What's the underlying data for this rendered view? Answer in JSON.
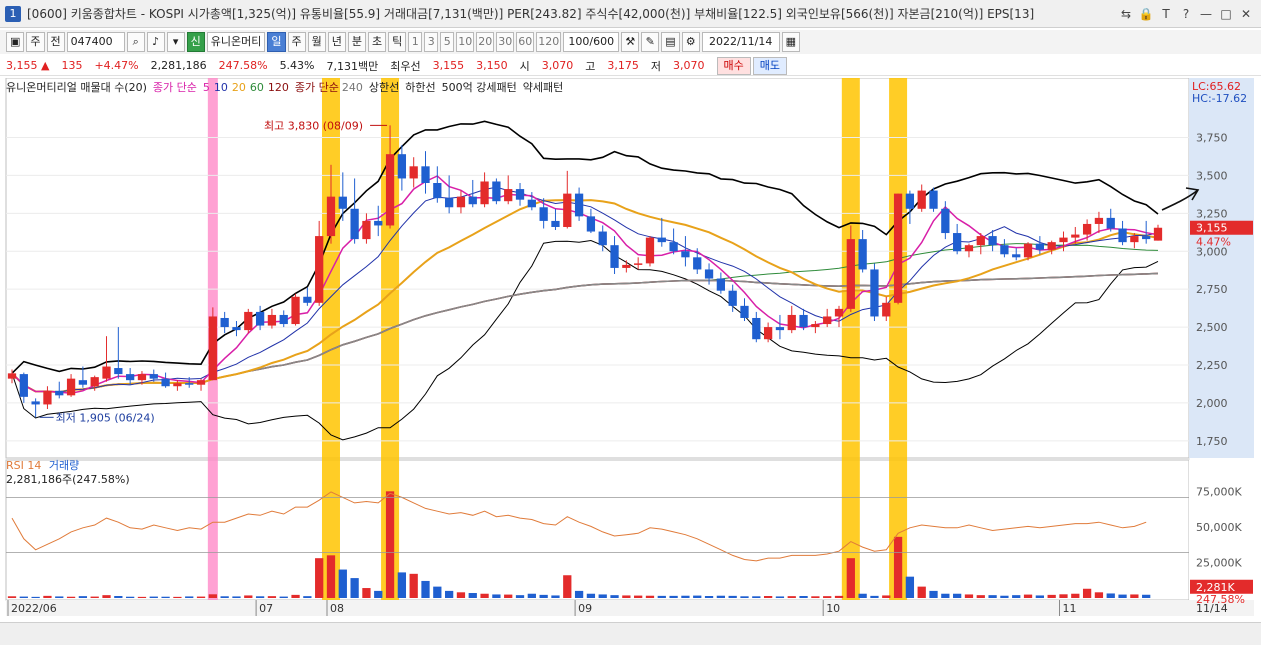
{
  "window": {
    "app_icon": "1",
    "title": "[0600] 키움종합차트 - KOSPI 시가총액[1,325(억)] 유통비율[55.9] 거래대금[7,131(백만)] PER[243.82] 주식수[42,000(천)] 부채비율[122.5] 외국인보유[566(천)] 자본금[210(억)] EPS[13]",
    "controls": [
      "⇆",
      "🔒",
      "T",
      "?",
      "—",
      "□",
      "✕"
    ]
  },
  "toolbar": {
    "period_select": "주",
    "prev": "전",
    "code": "047400",
    "name_prefix": "신",
    "name": "유니온머티",
    "periods": [
      "일",
      "주",
      "월",
      "년",
      "분",
      "초",
      "틱"
    ],
    "minutes": [
      "1",
      "3",
      "5",
      "10",
      "20",
      "30",
      "60",
      "120"
    ],
    "ratio": "100/600",
    "date": "2022/11/14"
  },
  "quote": {
    "price": "3,155 ▲",
    "change": "135",
    "change_pct": "+4.47%",
    "volume": "2,281,186",
    "vol_ratio": "247.58%",
    "turnover": "5.43%",
    "amount": "7,131백만",
    "best_label": "최우선",
    "best_ask": "3,155",
    "best_bid": "3,150",
    "open_label": "시",
    "open": "3,070",
    "high_label": "고",
    "high": "3,175",
    "low_label": "저",
    "low": "3,070",
    "buy": "매수",
    "sell": "매도"
  },
  "legend": {
    "vp_label": "유니온머티리얼 매물대 수(20)",
    "ma_label": "종가 단순",
    "ma_periods": [
      "5",
      "10",
      "20",
      "60",
      "120"
    ],
    "ma240_label": "종가 단순",
    "ma240": "240",
    "upper": "상한선",
    "lower": "하한선",
    "pattern_label": "500억 강세패턴",
    "weak": "약세패턴",
    "lc": "LC:65.62",
    "hc": "HC:-17.62",
    "rsi": "RSI 14",
    "vol": "거래량",
    "vol_value": "2,281,186주(247.58%)"
  },
  "colors": {
    "up": "#e32b2b",
    "down": "#1f5fd0",
    "ma5": "#d81fa8",
    "ma10": "#2233aa",
    "ma20": "#e8a21a",
    "ma60": "#2e8b3a",
    "ma120": "#8a0e0e",
    "ma240": "#888888",
    "band": "#000000",
    "highlight": "#ffc400",
    "pink": "#ff8ac8",
    "rsi": "#e07b3a"
  },
  "chart_data": {
    "type": "candlestick",
    "y_ticks": [
      "3,750",
      "3,500",
      "3,250",
      "3,000",
      "2,750",
      "2,500",
      "2,250",
      "2,000",
      "1,750"
    ],
    "ylim": [
      1650,
      4050
    ],
    "vol_ticks": [
      "75,000K",
      "50,000K",
      "25,000K"
    ],
    "vol_max": 90000,
    "x_labels": [
      "2022/06",
      "07",
      "08",
      "09",
      "10",
      "11"
    ],
    "x_label_right": "11/14",
    "current_price": "3,155",
    "current_pct": "4.47%",
    "current_vol": "2,281K",
    "current_vol_pct": "247.58%",
    "annot_high": "최고 3,830 (08/09)",
    "annot_low": "최저 1,905 (06/24)",
    "candles": [
      {
        "o": 2160,
        "h": 2220,
        "l": 2130,
        "c": 2195
      },
      {
        "o": 2190,
        "h": 2200,
        "l": 2000,
        "c": 2040
      },
      {
        "o": 2010,
        "h": 2030,
        "l": 1905,
        "c": 1990
      },
      {
        "o": 1990,
        "h": 2110,
        "l": 1960,
        "c": 2080
      },
      {
        "o": 2080,
        "h": 2140,
        "l": 2030,
        "c": 2050
      },
      {
        "o": 2050,
        "h": 2190,
        "l": 2040,
        "c": 2160
      },
      {
        "o": 2150,
        "h": 2240,
        "l": 2100,
        "c": 2120
      },
      {
        "o": 2110,
        "h": 2180,
        "l": 2080,
        "c": 2170
      },
      {
        "o": 2160,
        "h": 2440,
        "l": 2140,
        "c": 2240
      },
      {
        "o": 2230,
        "h": 2500,
        "l": 2160,
        "c": 2190
      },
      {
        "o": 2190,
        "h": 2230,
        "l": 2120,
        "c": 2150
      },
      {
        "o": 2150,
        "h": 2210,
        "l": 2120,
        "c": 2190
      },
      {
        "o": 2190,
        "h": 2220,
        "l": 2140,
        "c": 2160
      },
      {
        "o": 2160,
        "h": 2200,
        "l": 2100,
        "c": 2110
      },
      {
        "o": 2110,
        "h": 2150,
        "l": 2080,
        "c": 2130
      },
      {
        "o": 2130,
        "h": 2170,
        "l": 2100,
        "c": 2120
      },
      {
        "o": 2120,
        "h": 2160,
        "l": 2080,
        "c": 2150
      },
      {
        "o": 2150,
        "h": 2630,
        "l": 2150,
        "c": 2570
      },
      {
        "o": 2560,
        "h": 2600,
        "l": 2460,
        "c": 2500
      },
      {
        "o": 2500,
        "h": 2540,
        "l": 2440,
        "c": 2480
      },
      {
        "o": 2480,
        "h": 2620,
        "l": 2460,
        "c": 2600
      },
      {
        "o": 2600,
        "h": 2640,
        "l": 2480,
        "c": 2510
      },
      {
        "o": 2510,
        "h": 2620,
        "l": 2490,
        "c": 2580
      },
      {
        "o": 2580,
        "h": 2610,
        "l": 2500,
        "c": 2520
      },
      {
        "o": 2520,
        "h": 2720,
        "l": 2510,
        "c": 2700
      },
      {
        "o": 2700,
        "h": 2760,
        "l": 2640,
        "c": 2660
      },
      {
        "o": 2660,
        "h": 3200,
        "l": 2640,
        "c": 3100
      },
      {
        "o": 3100,
        "h": 3570,
        "l": 3050,
        "c": 3360
      },
      {
        "o": 3360,
        "h": 3520,
        "l": 3200,
        "c": 3280
      },
      {
        "o": 3280,
        "h": 3480,
        "l": 3050,
        "c": 3080
      },
      {
        "o": 3080,
        "h": 3250,
        "l": 3050,
        "c": 3200
      },
      {
        "o": 3200,
        "h": 3300,
        "l": 3100,
        "c": 3170
      },
      {
        "o": 3170,
        "h": 3830,
        "l": 3150,
        "c": 3640
      },
      {
        "o": 3640,
        "h": 3700,
        "l": 3400,
        "c": 3480
      },
      {
        "o": 3480,
        "h": 3620,
        "l": 3420,
        "c": 3560
      },
      {
        "o": 3560,
        "h": 3660,
        "l": 3380,
        "c": 3450
      },
      {
        "o": 3450,
        "h": 3560,
        "l": 3320,
        "c": 3350
      },
      {
        "o": 3350,
        "h": 3500,
        "l": 3250,
        "c": 3290
      },
      {
        "o": 3290,
        "h": 3400,
        "l": 3250,
        "c": 3360
      },
      {
        "o": 3360,
        "h": 3470,
        "l": 3290,
        "c": 3310
      },
      {
        "o": 3310,
        "h": 3520,
        "l": 3290,
        "c": 3460
      },
      {
        "o": 3460,
        "h": 3480,
        "l": 3310,
        "c": 3330
      },
      {
        "o": 3330,
        "h": 3500,
        "l": 3310,
        "c": 3410
      },
      {
        "o": 3410,
        "h": 3450,
        "l": 3300,
        "c": 3340
      },
      {
        "o": 3340,
        "h": 3390,
        "l": 3270,
        "c": 3290
      },
      {
        "o": 3290,
        "h": 3350,
        "l": 3150,
        "c": 3200
      },
      {
        "o": 3200,
        "h": 3280,
        "l": 3140,
        "c": 3160
      },
      {
        "o": 3160,
        "h": 3530,
        "l": 3150,
        "c": 3380
      },
      {
        "o": 3380,
        "h": 3420,
        "l": 3200,
        "c": 3230
      },
      {
        "o": 3230,
        "h": 3280,
        "l": 3120,
        "c": 3130
      },
      {
        "o": 3130,
        "h": 3170,
        "l": 3000,
        "c": 3040
      },
      {
        "o": 3040,
        "h": 3100,
        "l": 2850,
        "c": 2890
      },
      {
        "o": 2890,
        "h": 2940,
        "l": 2860,
        "c": 2910
      },
      {
        "o": 2910,
        "h": 2960,
        "l": 2880,
        "c": 2920
      },
      {
        "o": 2920,
        "h": 3100,
        "l": 2900,
        "c": 3090
      },
      {
        "o": 3090,
        "h": 3220,
        "l": 3030,
        "c": 3060
      },
      {
        "o": 3060,
        "h": 3150,
        "l": 2980,
        "c": 3000
      },
      {
        "o": 3000,
        "h": 3100,
        "l": 2900,
        "c": 2960
      },
      {
        "o": 2960,
        "h": 3020,
        "l": 2850,
        "c": 2880
      },
      {
        "o": 2880,
        "h": 2920,
        "l": 2780,
        "c": 2820
      },
      {
        "o": 2820,
        "h": 2860,
        "l": 2720,
        "c": 2740
      },
      {
        "o": 2740,
        "h": 2780,
        "l": 2600,
        "c": 2640
      },
      {
        "o": 2640,
        "h": 2690,
        "l": 2540,
        "c": 2560
      },
      {
        "o": 2560,
        "h": 2600,
        "l": 2400,
        "c": 2420
      },
      {
        "o": 2420,
        "h": 2530,
        "l": 2400,
        "c": 2500
      },
      {
        "o": 2500,
        "h": 2580,
        "l": 2420,
        "c": 2480
      },
      {
        "o": 2480,
        "h": 2640,
        "l": 2460,
        "c": 2580
      },
      {
        "o": 2580,
        "h": 2620,
        "l": 2480,
        "c": 2500
      },
      {
        "o": 2500,
        "h": 2540,
        "l": 2460,
        "c": 2520
      },
      {
        "o": 2520,
        "h": 2620,
        "l": 2500,
        "c": 2570
      },
      {
        "o": 2570,
        "h": 2640,
        "l": 2500,
        "c": 2620
      },
      {
        "o": 2620,
        "h": 3170,
        "l": 2600,
        "c": 3080
      },
      {
        "o": 3080,
        "h": 3140,
        "l": 2860,
        "c": 2880
      },
      {
        "o": 2880,
        "h": 2920,
        "l": 2540,
        "c": 2570
      },
      {
        "o": 2570,
        "h": 2700,
        "l": 2540,
        "c": 2660
      },
      {
        "o": 2660,
        "h": 3380,
        "l": 2650,
        "c": 3380
      },
      {
        "o": 3380,
        "h": 3400,
        "l": 3180,
        "c": 3280
      },
      {
        "o": 3280,
        "h": 3440,
        "l": 3260,
        "c": 3400
      },
      {
        "o": 3400,
        "h": 3420,
        "l": 3260,
        "c": 3280
      },
      {
        "o": 3280,
        "h": 3330,
        "l": 3080,
        "c": 3120
      },
      {
        "o": 3120,
        "h": 3180,
        "l": 2980,
        "c": 3000
      },
      {
        "o": 3000,
        "h": 3050,
        "l": 2960,
        "c": 3040
      },
      {
        "o": 3040,
        "h": 3120,
        "l": 2980,
        "c": 3100
      },
      {
        "o": 3100,
        "h": 3140,
        "l": 3000,
        "c": 3040
      },
      {
        "o": 3040,
        "h": 3080,
        "l": 2960,
        "c": 2980
      },
      {
        "o": 2980,
        "h": 3020,
        "l": 2940,
        "c": 2960
      },
      {
        "o": 2960,
        "h": 3060,
        "l": 2940,
        "c": 3050
      },
      {
        "o": 3050,
        "h": 3100,
        "l": 2980,
        "c": 3010
      },
      {
        "o": 3010,
        "h": 3070,
        "l": 2980,
        "c": 3060
      },
      {
        "o": 3060,
        "h": 3130,
        "l": 3000,
        "c": 3090
      },
      {
        "o": 3090,
        "h": 3160,
        "l": 3050,
        "c": 3110
      },
      {
        "o": 3110,
        "h": 3210,
        "l": 3070,
        "c": 3180
      },
      {
        "o": 3180,
        "h": 3260,
        "l": 3120,
        "c": 3220
      },
      {
        "o": 3220,
        "h": 3280,
        "l": 3130,
        "c": 3150
      },
      {
        "o": 3150,
        "h": 3200,
        "l": 3040,
        "c": 3060
      },
      {
        "o": 3060,
        "h": 3120,
        "l": 3020,
        "c": 3100
      },
      {
        "o": 3100,
        "h": 3200,
        "l": 3050,
        "c": 3080
      },
      {
        "o": 3070,
        "h": 3175,
        "l": 3070,
        "c": 3155
      }
    ],
    "volume": [
      1.2,
      1.0,
      0.8,
      1.5,
      1.1,
      0.9,
      1.3,
      1.0,
      2.0,
      1.4,
      0.9,
      0.8,
      1.0,
      0.9,
      0.8,
      1.1,
      1.0,
      2.6,
      1.2,
      1.1,
      1.8,
      1.2,
      1.3,
      1.0,
      2.2,
      1.3,
      28.0,
      30.0,
      20.0,
      14.0,
      7.0,
      5.0,
      75.0,
      18.0,
      17.0,
      12.0,
      8.0,
      5.0,
      4.0,
      3.5,
      3.0,
      2.5,
      2.4,
      2.0,
      3.0,
      2.2,
      1.8,
      16.0,
      5.0,
      3.0,
      2.5,
      2.0,
      1.8,
      1.7,
      1.6,
      1.5,
      1.5,
      1.6,
      1.7,
      1.4,
      1.6,
      1.5,
      1.2,
      1.2,
      1.4,
      1.1,
      1.3,
      1.4,
      1.2,
      1.3,
      1.5,
      28.0,
      3.0,
      1.5,
      1.8,
      43.0,
      15.0,
      8.0,
      5.0,
      3.0,
      3.0,
      2.5,
      2.0,
      2.0,
      1.6,
      2.0,
      2.4,
      1.8,
      2.2,
      2.6,
      3.0,
      6.5,
      4.0,
      3.2,
      2.4,
      2.5,
      2.281
    ],
    "rsi": [
      55,
      40,
      32,
      36,
      40,
      45,
      48,
      50,
      55,
      52,
      48,
      47,
      50,
      48,
      46,
      48,
      47,
      52,
      52,
      55,
      58,
      57,
      60,
      58,
      63,
      63,
      68,
      74,
      70,
      66,
      67,
      66,
      73,
      70,
      66,
      62,
      60,
      58,
      59,
      57,
      60,
      56,
      57,
      55,
      54,
      51,
      50,
      56,
      52,
      49,
      45,
      42,
      43,
      44,
      48,
      47,
      45,
      43,
      40,
      36,
      32,
      28,
      25,
      24,
      26,
      26,
      28,
      28,
      28,
      29,
      31,
      38,
      34,
      31,
      32,
      44,
      48,
      50,
      49,
      48,
      48,
      50,
      48,
      46,
      47,
      48,
      49,
      48,
      49,
      50,
      51,
      51,
      52,
      50,
      48,
      49,
      52
    ],
    "highlights": [
      27,
      32,
      71,
      75
    ],
    "pink_col": 17
  }
}
